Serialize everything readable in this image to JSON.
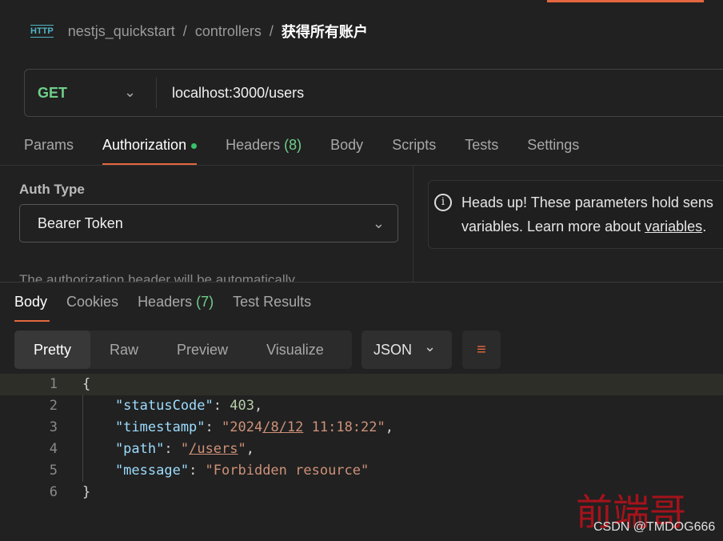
{
  "breadcrumb": {
    "icon": "HTTP",
    "collection": "nestjs_quickstart",
    "folder": "controllers",
    "request": "获得所有账户",
    "sep": "/"
  },
  "request": {
    "method": "GET",
    "url": "localhost:3000/users"
  },
  "request_tabs": [
    {
      "label": "Params"
    },
    {
      "label": "Authorization",
      "active": true,
      "dot": true
    },
    {
      "label": "Headers",
      "count": "(8)"
    },
    {
      "label": "Body"
    },
    {
      "label": "Scripts"
    },
    {
      "label": "Tests"
    },
    {
      "label": "Settings"
    }
  ],
  "auth": {
    "label": "Auth Type",
    "type": "Bearer Token",
    "cut_text": "The authorization header will be automatically"
  },
  "info": {
    "line1": "Heads up! These parameters hold sens",
    "line2_prefix": "variables. Learn more about ",
    "link": "variables",
    "line2_suffix": "."
  },
  "response_tabs": [
    {
      "label": "Body",
      "active": true
    },
    {
      "label": "Cookies"
    },
    {
      "label": "Headers",
      "count": "(7)"
    },
    {
      "label": "Test Results"
    }
  ],
  "view_modes": [
    "Pretty",
    "Raw",
    "Preview",
    "Visualize"
  ],
  "format": "JSON",
  "code_lines": [
    [
      {
        "t": "{",
        "c": "p"
      }
    ],
    [
      {
        "t": "    \"statusCode\"",
        "c": "k"
      },
      {
        "t": ": ",
        "c": "p"
      },
      {
        "t": "403",
        "c": "n"
      },
      {
        "t": ",",
        "c": "p"
      }
    ],
    [
      {
        "t": "    \"timestamp\"",
        "c": "k"
      },
      {
        "t": ": ",
        "c": "p"
      },
      {
        "t": "\"2024",
        "c": "s"
      },
      {
        "t": "/8/12",
        "c": "s ul"
      },
      {
        "t": " 11:18:22\"",
        "c": "s"
      },
      {
        "t": ",",
        "c": "p"
      }
    ],
    [
      {
        "t": "    \"path\"",
        "c": "k"
      },
      {
        "t": ": ",
        "c": "p"
      },
      {
        "t": "\"",
        "c": "s"
      },
      {
        "t": "/users",
        "c": "s ul"
      },
      {
        "t": "\"",
        "c": "s"
      },
      {
        "t": ",",
        "c": "p"
      }
    ],
    [
      {
        "t": "    \"message\"",
        "c": "k"
      },
      {
        "t": ": ",
        "c": "p"
      },
      {
        "t": "\"Forbidden resource\"",
        "c": "s"
      }
    ],
    [
      {
        "t": "}",
        "c": "p"
      }
    ]
  ],
  "watermark": {
    "text": "前端哥",
    "credit": "CSDN @TMDOG666"
  },
  "colors": {
    "accent": "#e5673f",
    "method": "#6fcf8a",
    "background": "#212121"
  }
}
